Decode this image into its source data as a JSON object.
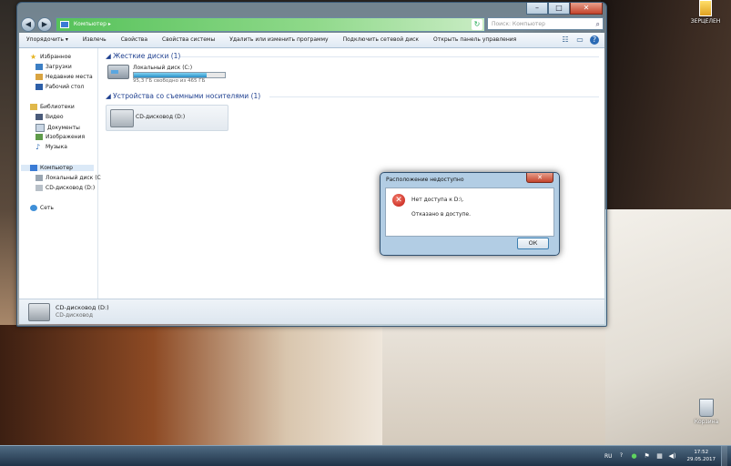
{
  "desktop": {
    "top_icon_label": "ЗЕРЦЕЛЕН",
    "recycle_label": "Корзина"
  },
  "window": {
    "breadcrumb": "Компьютер",
    "search_placeholder": "Поиск: Компьютер",
    "controls": {
      "minimize": "–",
      "maximize": "□",
      "close": "✕"
    },
    "toolbar": {
      "organize": "Упорядочить ▾",
      "eject": "Извлечь",
      "properties": "Свойства",
      "system_properties": "Свойства системы",
      "uninstall": "Удалить или изменить программу",
      "map_drive": "Подключить сетевой диск",
      "control_panel": "Открыть панель управления"
    },
    "nav": {
      "favorites": "Избранное",
      "downloads": "Загрузки",
      "recent": "Недавние места",
      "desktop": "Рабочий стол",
      "libraries": "Библиотеки",
      "video": "Видео",
      "documents": "Документы",
      "images": "Изображения",
      "music": "Музыка",
      "computer": "Компьютер",
      "local_disk": "Локальный диск (C",
      "cd_drive": "CD-дисковод (D:)",
      "network": "Сеть"
    },
    "hard_disks_header": "Жесткие диски (1)",
    "local_disk": {
      "name": "Локальный диск (C:)",
      "free": "95,3 ГБ свободно из 465 ГБ",
      "used_fraction": 0.795
    },
    "removable_header": "Устройства со съемными носителями (1)",
    "cd_drive": {
      "name": "CD-дисковод (D:)"
    },
    "details": {
      "name": "CD-дисковод (D:)",
      "type": "CD-дисковод"
    }
  },
  "dialog": {
    "title": "Расположение недоступно",
    "close": "✕",
    "message_line1": "Нет доступа к D:\\.",
    "message_line2": "Отказано в доступе.",
    "ok": "ОК",
    "error_glyph": "✕"
  },
  "taskbar": {
    "language": "RU",
    "time": "17:52",
    "date": "29.05.2017"
  }
}
